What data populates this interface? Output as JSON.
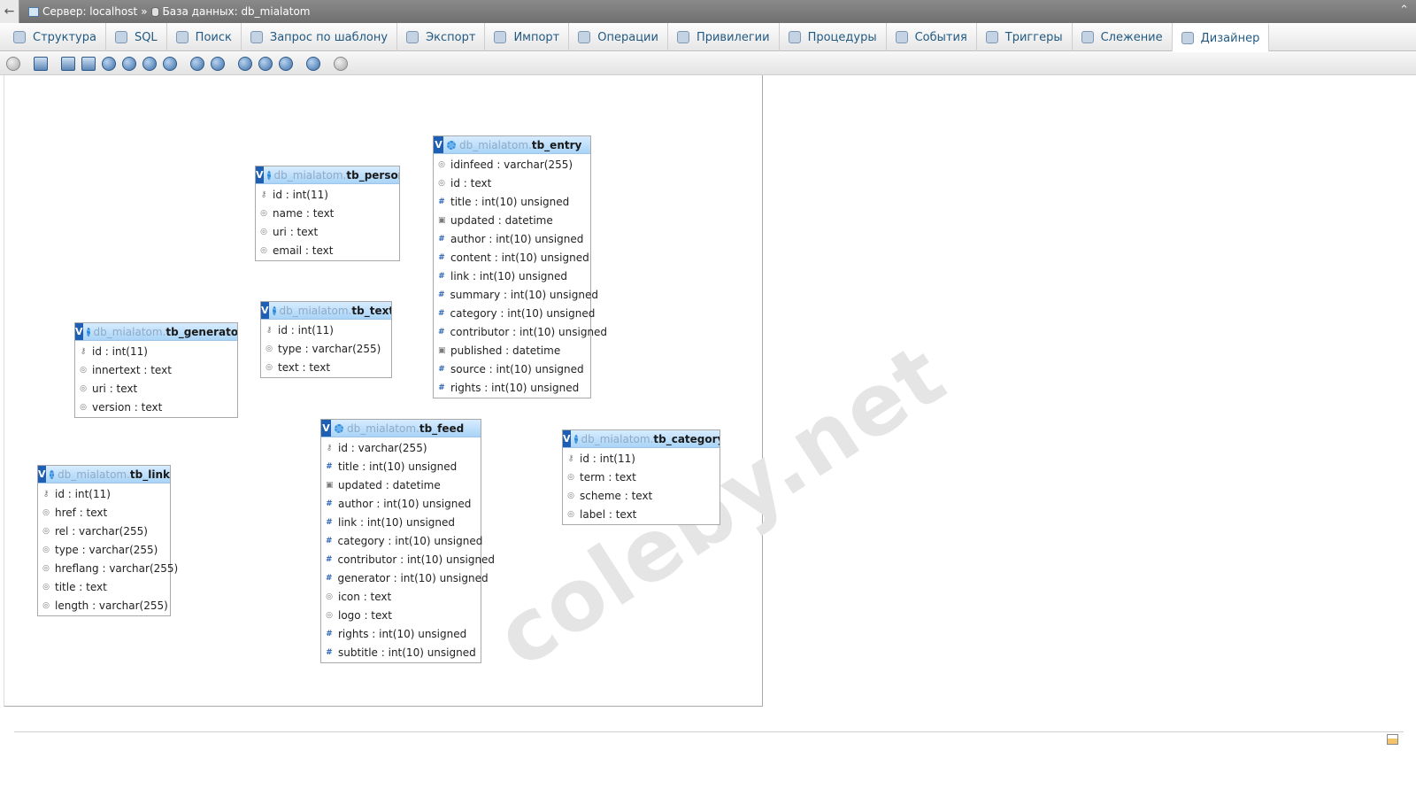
{
  "breadcrumb": {
    "server_label": "Сервер: localhost",
    "separator": "»",
    "database_label": "База данных: db_mialatom"
  },
  "tabs": [
    {
      "label": "Структура",
      "icon": "structure-icon"
    },
    {
      "label": "SQL",
      "icon": "sql-icon"
    },
    {
      "label": "Поиск",
      "icon": "search-icon"
    },
    {
      "label": "Запрос по шаблону",
      "icon": "query-icon"
    },
    {
      "label": "Экспорт",
      "icon": "export-icon"
    },
    {
      "label": "Импорт",
      "icon": "import-icon"
    },
    {
      "label": "Операции",
      "icon": "operations-icon"
    },
    {
      "label": "Привилегии",
      "icon": "privileges-icon"
    },
    {
      "label": "Процедуры",
      "icon": "routines-icon"
    },
    {
      "label": "События",
      "icon": "events-icon"
    },
    {
      "label": "Триггеры",
      "icon": "triggers-icon"
    },
    {
      "label": "Слежение",
      "icon": "tracking-icon"
    },
    {
      "label": "Дизайнер",
      "icon": "designer-icon",
      "active": true
    }
  ],
  "designer": {
    "db_prefix": "db_mialatom.",
    "watermark": "coleby.net",
    "tables": [
      {
        "name": "tb_person",
        "columns": [
          {
            "field": "id : int(11)",
            "kind": "key"
          },
          {
            "field": "name : text",
            "kind": "text"
          },
          {
            "field": "uri : text",
            "kind": "text"
          },
          {
            "field": "email : text",
            "kind": "text"
          }
        ]
      },
      {
        "name": "tb_entry",
        "columns": [
          {
            "field": "idinfeed : varchar(255)",
            "kind": "text"
          },
          {
            "field": "id : text",
            "kind": "text"
          },
          {
            "field": "title : int(10) unsigned",
            "kind": "num"
          },
          {
            "field": "updated : datetime",
            "kind": "date"
          },
          {
            "field": "author : int(10) unsigned",
            "kind": "num"
          },
          {
            "field": "content : int(10) unsigned",
            "kind": "num"
          },
          {
            "field": "link : int(10) unsigned",
            "kind": "num"
          },
          {
            "field": "summary : int(10) unsigned",
            "kind": "num"
          },
          {
            "field": "category : int(10) unsigned",
            "kind": "num"
          },
          {
            "field": "contributor : int(10) unsigned",
            "kind": "num"
          },
          {
            "field": "published : datetime",
            "kind": "date"
          },
          {
            "field": "source : int(10) unsigned",
            "kind": "num"
          },
          {
            "field": "rights : int(10) unsigned",
            "kind": "num"
          }
        ]
      },
      {
        "name": "tb_text",
        "columns": [
          {
            "field": "id : int(11)",
            "kind": "key"
          },
          {
            "field": "type : varchar(255)",
            "kind": "text"
          },
          {
            "field": "text : text",
            "kind": "text"
          }
        ]
      },
      {
        "name": "tb_generator",
        "columns": [
          {
            "field": "id : int(11)",
            "kind": "key"
          },
          {
            "field": "innertext : text",
            "kind": "text"
          },
          {
            "field": "uri : text",
            "kind": "text"
          },
          {
            "field": "version : text",
            "kind": "text"
          }
        ]
      },
      {
        "name": "tb_feed",
        "columns": [
          {
            "field": "id : varchar(255)",
            "kind": "key"
          },
          {
            "field": "title : int(10) unsigned",
            "kind": "num"
          },
          {
            "field": "updated : datetime",
            "kind": "date"
          },
          {
            "field": "author : int(10) unsigned",
            "kind": "num"
          },
          {
            "field": "link : int(10) unsigned",
            "kind": "num"
          },
          {
            "field": "category : int(10) unsigned",
            "kind": "num"
          },
          {
            "field": "contributor : int(10) unsigned",
            "kind": "num"
          },
          {
            "field": "generator : int(10) unsigned",
            "kind": "num"
          },
          {
            "field": "icon : text",
            "kind": "text"
          },
          {
            "field": "logo : text",
            "kind": "text"
          },
          {
            "field": "rights : int(10) unsigned",
            "kind": "num"
          },
          {
            "field": "subtitle : int(10) unsigned",
            "kind": "num"
          }
        ]
      },
      {
        "name": "tb_category",
        "columns": [
          {
            "field": "id : int(11)",
            "kind": "key"
          },
          {
            "field": "term : text",
            "kind": "text"
          },
          {
            "field": "scheme : text",
            "kind": "text"
          },
          {
            "field": "label : text",
            "kind": "text"
          }
        ]
      },
      {
        "name": "tb_link",
        "columns": [
          {
            "field": "id : int(11)",
            "kind": "key"
          },
          {
            "field": "href : text",
            "kind": "text"
          },
          {
            "field": "rel : varchar(255)",
            "kind": "text"
          },
          {
            "field": "type : varchar(255)",
            "kind": "text"
          },
          {
            "field": "hreflang : varchar(255)",
            "kind": "text"
          },
          {
            "field": "title : text",
            "kind": "text"
          },
          {
            "field": "length : varchar(255)",
            "kind": "text"
          }
        ]
      }
    ]
  },
  "colors": {
    "tab_text": "#235a81",
    "table_header": "#a9d4f7",
    "table_toggle": "#1f5fb3"
  }
}
